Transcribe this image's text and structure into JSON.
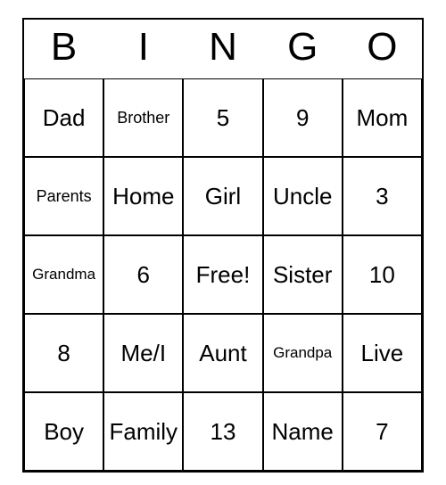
{
  "header": [
    "B",
    "I",
    "N",
    "G",
    "O"
  ],
  "grid": [
    [
      {
        "text": "Dad",
        "size": "normal"
      },
      {
        "text": "Brother",
        "size": "small"
      },
      {
        "text": "5",
        "size": "normal"
      },
      {
        "text": "9",
        "size": "normal"
      },
      {
        "text": "Mom",
        "size": "normal"
      }
    ],
    [
      {
        "text": "Parents",
        "size": "small"
      },
      {
        "text": "Home",
        "size": "normal"
      },
      {
        "text": "Girl",
        "size": "normal"
      },
      {
        "text": "Uncle",
        "size": "normal"
      },
      {
        "text": "3",
        "size": "normal"
      }
    ],
    [
      {
        "text": "Grandma",
        "size": "xsmall"
      },
      {
        "text": "6",
        "size": "normal"
      },
      {
        "text": "Free!",
        "size": "normal"
      },
      {
        "text": "Sister",
        "size": "normal"
      },
      {
        "text": "10",
        "size": "normal"
      }
    ],
    [
      {
        "text": "8",
        "size": "normal"
      },
      {
        "text": "Me/I",
        "size": "normal"
      },
      {
        "text": "Aunt",
        "size": "normal"
      },
      {
        "text": "Grandpa",
        "size": "xsmall"
      },
      {
        "text": "Live",
        "size": "normal"
      }
    ],
    [
      {
        "text": "Boy",
        "size": "normal"
      },
      {
        "text": "Family",
        "size": "normal"
      },
      {
        "text": "13",
        "size": "normal"
      },
      {
        "text": "Name",
        "size": "normal"
      },
      {
        "text": "7",
        "size": "normal"
      }
    ]
  ]
}
